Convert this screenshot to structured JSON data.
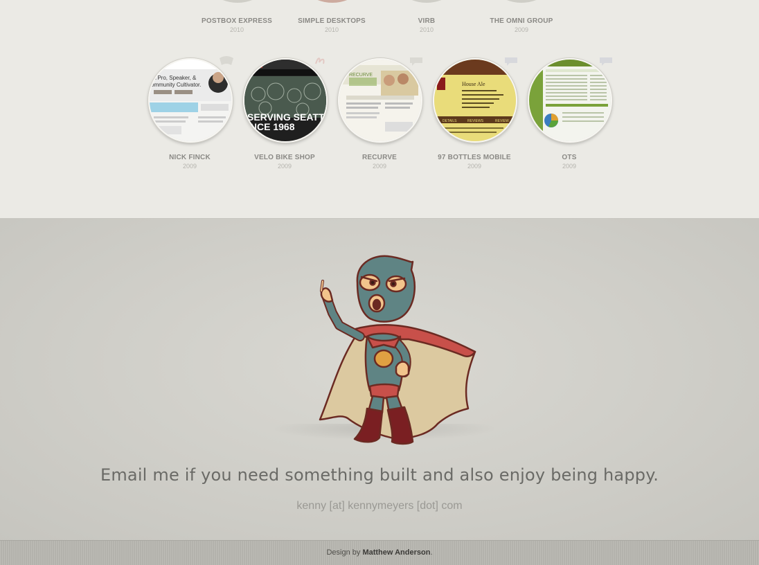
{
  "portfolio": {
    "top_row": [
      {
        "title": "POSTBOX EXPRESS",
        "year": "2010"
      },
      {
        "title": "SIMPLE DESKTOPS",
        "year": "2010"
      },
      {
        "title": "VIRB",
        "year": "2010"
      },
      {
        "title": "THE OMNI GROUP",
        "year": "2009"
      }
    ],
    "bottom_row": [
      {
        "title": "NICK FINCK",
        "year": "2009",
        "thumb_lines": [
          "IA Pro, Speaker, &",
          "ommunity Cultivator."
        ]
      },
      {
        "title": "VELO BIKE SHOP",
        "year": "2009",
        "thumb_lines": [
          "SERVING SEATT",
          "INCE 1968"
        ]
      },
      {
        "title": "RECURVE",
        "year": "2009",
        "thumb_lines": [
          "RECURVE"
        ]
      },
      {
        "title": "97 BOTTLES MOBILE",
        "year": "2009",
        "thumb_lines": [
          "House Ale",
          "DETAILS",
          "REVIEWS",
          "REVIEW"
        ]
      },
      {
        "title": "OTS",
        "year": "2009",
        "thumb_lines": []
      }
    ]
  },
  "contact": {
    "headline": "Email me if you need something built and also enjoy being happy.",
    "email": "kenny [at] kennymeyers [dot] com"
  },
  "footer": {
    "prefix": "Design by",
    "designer": "Matthew Anderson",
    "suffix": "."
  },
  "colors": {
    "page_bg": "#ebeae5",
    "contact_bg": "#d3d2cc",
    "mask_teal": "#5f8484",
    "cape_red": "#c8504a",
    "cape_tan": "#dcc9a0",
    "boot_maroon": "#7a1f22"
  }
}
